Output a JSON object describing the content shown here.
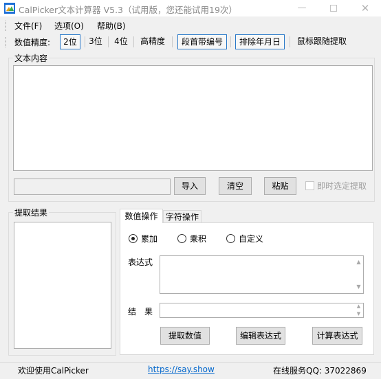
{
  "window": {
    "title": "CalPicker文本计算器 V5.3（试用版，您还能试用19次）",
    "minimize_glyph": "—",
    "close_glyph": "✕"
  },
  "menu": {
    "file": "文件(F)",
    "options": "选项(O)",
    "help": "帮助(B)"
  },
  "toolbar": {
    "precision_label": "数值精度:",
    "p2": "2位",
    "p3": "3位",
    "p4": "4位",
    "high": "高精度",
    "paragraph_number": "段首带编号",
    "exclude_date": "排除年月日",
    "mouse_follow": "鼠标跟随提取"
  },
  "text_content": {
    "title": "文本内容",
    "value": ""
  },
  "actions": {
    "import": "导入",
    "clear": "清空",
    "paste": "粘贴",
    "instant_extract": "即时选定提取",
    "instant_extract_checked": false,
    "path_value": ""
  },
  "results": {
    "title": "提取结果",
    "value": ""
  },
  "tabs": {
    "numeric": "数值操作",
    "string": "字符操作",
    "selected": "numeric"
  },
  "numeric": {
    "sum": "累加",
    "product": "乘积",
    "custom": "自定义",
    "selected_mode": "sum",
    "expression_label": "表达式",
    "expression_value": "",
    "result_label": "结　果",
    "result_value": "",
    "extract_button": "提取数值",
    "edit_button": "编辑表达式",
    "calc_button": "计算表达式",
    "arrow_up": "▲",
    "arrow_down": "▼"
  },
  "status": {
    "welcome": "欢迎使用CalPicker",
    "link": "https://say.show",
    "qq": "在线服务QQ: 37022869"
  },
  "colors": {
    "accent": "#2a79c9",
    "link": "#0066cc"
  }
}
